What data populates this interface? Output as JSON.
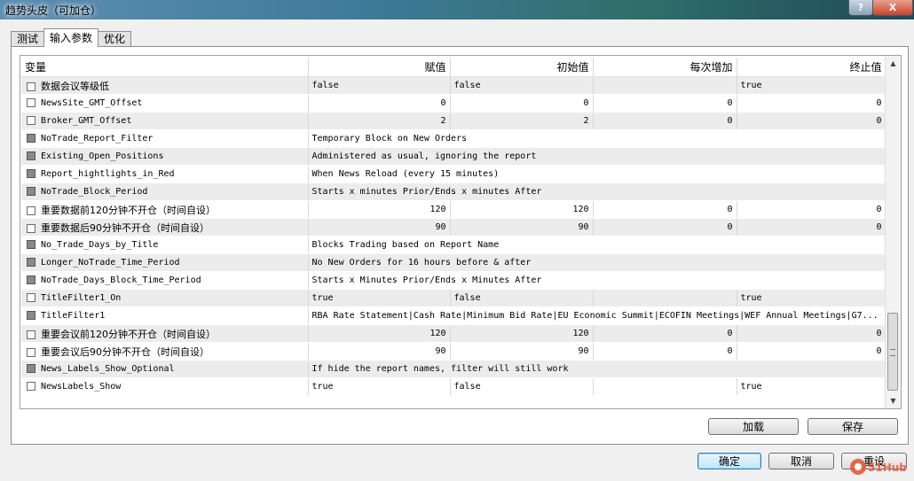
{
  "window": {
    "title": "趋势头皮（可加仓）",
    "help_label": "?",
    "close_label": "X"
  },
  "tabs": [
    {
      "label": "测试"
    },
    {
      "label": "输入参数"
    },
    {
      "label": "优化"
    }
  ],
  "grid": {
    "headers": [
      "变量",
      "赋值",
      "初始值",
      "每次增加",
      "终止值"
    ],
    "rows": [
      {
        "name": "数据会议等级低",
        "check": "white",
        "value": "false",
        "start": "false",
        "step": "",
        "stop": "true",
        "merged": false,
        "numeric": false
      },
      {
        "name": "NewsSite_GMT_Offset",
        "check": "white",
        "value": "0",
        "start": "0",
        "step": "0",
        "stop": "0",
        "merged": false,
        "numeric": true
      },
      {
        "name": "Broker_GMT_Offset",
        "check": "white",
        "value": "2",
        "start": "2",
        "step": "0",
        "stop": "0",
        "merged": false,
        "numeric": true
      },
      {
        "name": "NoTrade_Report_Filter",
        "check": "gray",
        "value": "Temporary Block on New Orders",
        "start": "",
        "step": "",
        "stop": "",
        "merged": true,
        "numeric": false
      },
      {
        "name": "Existing_Open_Positions",
        "check": "gray",
        "value": "Administered as usual, ignoring the report",
        "start": "",
        "step": "",
        "stop": "",
        "merged": true,
        "numeric": false
      },
      {
        "name": "Report_hightlights_in_Red",
        "check": "gray",
        "value": "When News Reload (every 15 minutes)",
        "start": "",
        "step": "",
        "stop": "",
        "merged": true,
        "numeric": false
      },
      {
        "name": "NoTrade_Block_Period",
        "check": "gray",
        "value": " Starts x minutes Prior/Ends x minutes After",
        "start": "",
        "step": "",
        "stop": "",
        "merged": true,
        "numeric": false
      },
      {
        "name": "重要数据前120分钟不开仓（时间自设）",
        "check": "white",
        "value": "120",
        "start": "120",
        "step": "0",
        "stop": "0",
        "merged": false,
        "numeric": true
      },
      {
        "name": "重要数据后90分钟不开仓（时间自设）",
        "check": "white",
        "value": "90",
        "start": "90",
        "step": "0",
        "stop": "0",
        "merged": false,
        "numeric": true
      },
      {
        "name": "No_Trade_Days_by_Title",
        "check": "gray",
        "value": "Blocks Trading based on Report Name",
        "start": "",
        "step": "",
        "stop": "",
        "merged": true,
        "numeric": false
      },
      {
        "name": "Longer_NoTrade_Time_Period",
        "check": "gray",
        "value": "No New Orders for 16 hours before & after",
        "start": "",
        "step": "",
        "stop": "",
        "merged": true,
        "numeric": false
      },
      {
        "name": "NoTrade_Days_Block_Time_Period",
        "check": "gray",
        "value": "Starts x Minutes Prior/Ends x Minutes After",
        "start": "",
        "step": "",
        "stop": "",
        "merged": true,
        "numeric": false
      },
      {
        "name": "TitleFilter1_On",
        "check": "white",
        "value": "true",
        "start": "false",
        "step": "",
        "stop": "true",
        "merged": false,
        "numeric": false
      },
      {
        "name": "TitleFilter1",
        "check": "gray",
        "value": "RBA Rate Statement|Cash Rate|Minimum Bid Rate|EU Economic Summit|ECOFIN Meetings|WEF Annual Meetings|G7...",
        "start": "",
        "step": "",
        "stop": "",
        "merged": true,
        "numeric": false
      },
      {
        "name": "重要会议前120分钟不开仓（时间自设）",
        "check": "white",
        "value": "120",
        "start": "120",
        "step": "0",
        "stop": "0",
        "merged": false,
        "numeric": true
      },
      {
        "name": "重要会议后90分钟不开仓（时间自设）",
        "check": "white",
        "value": "90",
        "start": "90",
        "step": "0",
        "stop": "0",
        "merged": false,
        "numeric": true
      },
      {
        "name": "News_Labels_Show_Optional",
        "check": "gray",
        "value": " If hide the report names, filter will still work",
        "start": "",
        "step": "",
        "stop": "",
        "merged": true,
        "numeric": false
      },
      {
        "name": "NewsLabels_Show",
        "check": "white",
        "value": "true",
        "start": "false",
        "step": "",
        "stop": "true",
        "merged": false,
        "numeric": false
      }
    ]
  },
  "buttons": {
    "load": "加载",
    "save": "保存",
    "ok": "确定",
    "cancel": "取消",
    "reset": "重设"
  },
  "watermark": {
    "text": "51Hub"
  }
}
